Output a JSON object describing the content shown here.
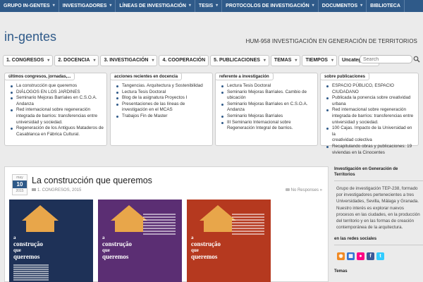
{
  "topnav": [
    {
      "label": "GRUPO IN-GENTES",
      "has_dropdown": true
    },
    {
      "label": "INVESTIGADORES",
      "has_dropdown": true
    },
    {
      "label": "LÍNEAS DE INVESTIGACIÓN",
      "has_dropdown": true
    },
    {
      "label": "TESIS",
      "has_dropdown": true
    },
    {
      "label": "PROTOCOLOS DE INVESTIGACIÓN",
      "has_dropdown": true
    },
    {
      "label": "DOCUMENTOS",
      "has_dropdown": true
    },
    {
      "label": "BIBLIOTECA",
      "has_dropdown": false
    }
  ],
  "site": {
    "title": "in-gentes",
    "tagline": "HUM-958 INVESTIGACIÓN EN GENERACIÓN DE TERRITORIOS"
  },
  "secnav": [
    {
      "label": "1. CONGRESOS",
      "has_dropdown": true
    },
    {
      "label": "2. DOCENCIA",
      "has_dropdown": true
    },
    {
      "label": "3. INVESTIGACIÓN",
      "has_dropdown": true
    },
    {
      "label": "4. COOPERACIÓN",
      "has_dropdown": false
    },
    {
      "label": "5. PUBLICACIONES",
      "has_dropdown": true
    },
    {
      "label": "TEMAS",
      "has_dropdown": true
    },
    {
      "label": "TIEMPOS",
      "has_dropdown": true
    },
    {
      "label": "Uncategorized",
      "has_dropdown": false
    }
  ],
  "search": {
    "placeholder": "Search"
  },
  "widgets": [
    {
      "title": "últimos congresos, jornadas,...",
      "items": [
        [
          "La construcción que queremos"
        ],
        [
          "DIÁLOGOS EN LOS JARDINES"
        ],
        [
          "Seminario Mejoras Barriales en C.S.O.A.",
          "Andanza"
        ],
        [
          "Red internacional sobre regeneración",
          "integrada de barrios: transferencias entre",
          "universidad y sociedad."
        ],
        [
          "Regeneración de los Antiguos Mataderos de",
          "Casablanca en Fábrica Cultural."
        ]
      ]
    },
    {
      "title": "acciones recientes en docencia",
      "items": [
        [
          "Tangencias. Arquitectura y Sostenibilidad"
        ],
        [
          "Lectura Tesis Doctoral"
        ],
        [
          "Blog de la asignatura Proyectos I"
        ],
        [
          "Presentaciones de las líneas de",
          "investigación en el MCAS"
        ],
        [
          "Trabajos Fin de Master"
        ]
      ]
    },
    {
      "title": "referente a investigación",
      "items": [
        [
          "Lectura Tesis Doctoral"
        ],
        [
          "Seminario Mejoras Barriales. Cambio de",
          "ubicación"
        ],
        [
          "Seminario Mejoras Barriales en C.S.O.A.",
          "Andanza"
        ],
        [
          "Seminario Mejoras Barriales"
        ],
        [
          "III Seminario Internacional sobre",
          "Regeneración Integral de barrios."
        ]
      ]
    },
    {
      "title": "sobre publicaciones",
      "items": [
        [
          "ESPACIO PÚBLICO, ESPACIO CIUDADANO"
        ],
        [
          "Publicada la ponencia sobre creatividad",
          "urbana"
        ],
        [
          "Red internacional sobre regeneración",
          "integrada de barrios: transferencias entre",
          "universidad y sociedad."
        ],
        [
          "100 Cajas. Impacto de la Universidad en la",
          "creatividad colectiva"
        ],
        [
          "Recapitulando obras y publicaciones: 19",
          "viviendas en la Cinocentes"
        ]
      ]
    }
  ],
  "post": {
    "month": "may",
    "day": "10",
    "year": "2015",
    "title": "La construcción que queremos",
    "category": "1. CONGRESOS, 2015",
    "comments": "No Responses »",
    "poster_lines": [
      "a",
      "construção",
      "que",
      "queremos"
    ],
    "colors": [
      "#1e3157",
      "#5b2e73",
      "#b5391f"
    ]
  },
  "sidebar": {
    "block1_title": "Investigación en Generación de Territorios",
    "block1_text": [
      "Grupo de investigación TEP-238, formado",
      "por investigadores pertenecientes a tres",
      "Universidades, Sevilla, Málaga y Granada.",
      "Nuestro interés es explorar nuevos",
      "procesos en las ciudades, en la producción",
      "del territorio y en las formas de creación",
      "contemporánea de la arquitectura."
    ],
    "block2_title": "en las redes sociales",
    "social": [
      "rss-icon",
      "delicious-icon",
      "flickr-icon",
      "facebook-icon",
      "twitter-icon"
    ],
    "block3_title": "Temas"
  }
}
